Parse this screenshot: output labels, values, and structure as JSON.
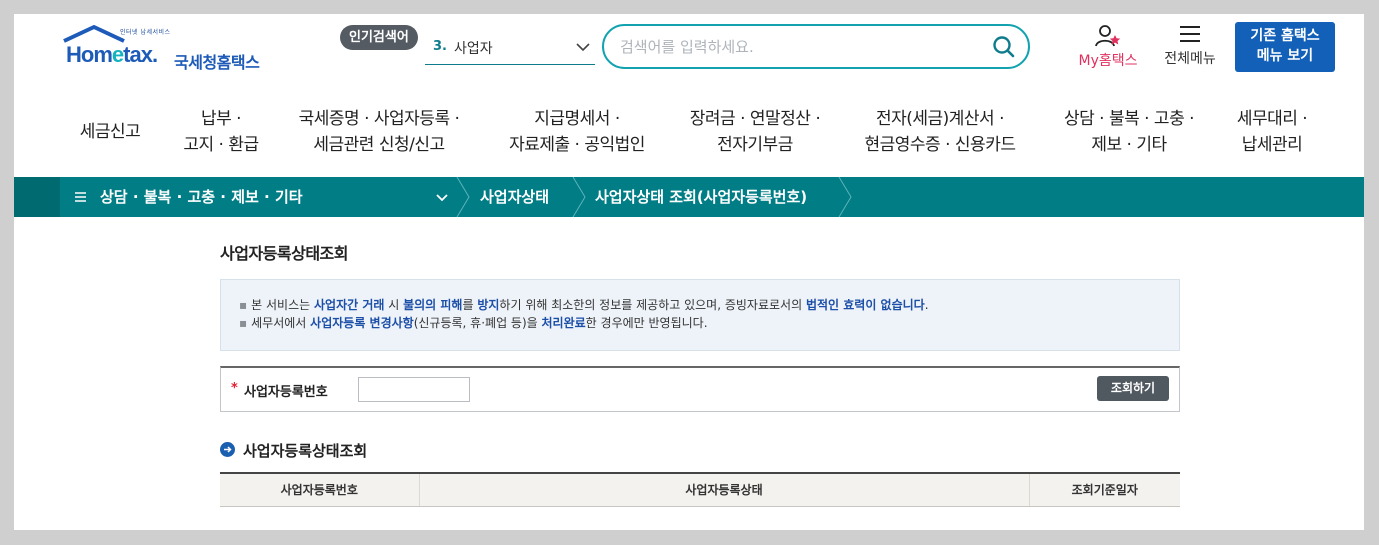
{
  "header": {
    "logo": {
      "tagline": "인터넷 납세서비스",
      "brand_prefix": "Hom",
      "brand_e": "e",
      "brand_suffix": "tax.",
      "brand_ko": "국세청홈택스"
    },
    "popular_label": "인기검색어",
    "popular_rank": "3.",
    "popular_keyword": "사업자",
    "search_placeholder": "검색어를 입력하세요.",
    "my_hometax_label": "My홈택스",
    "full_menu_label": "전체메뉴",
    "legacy_button": [
      "기존 홈택스",
      "메뉴 보기"
    ]
  },
  "nav": [
    {
      "lines": [
        "세금신고"
      ]
    },
    {
      "lines": [
        "납부 ·",
        "고지 · 환급"
      ]
    },
    {
      "lines": [
        "국세증명 · 사업자등록 ·",
        "세금관련 신청/신고"
      ]
    },
    {
      "lines": [
        "지급명세서 ·",
        "자료제출 · 공익법인"
      ]
    },
    {
      "lines": [
        "장려금 · 연말정산 ·",
        "전자기부금"
      ]
    },
    {
      "lines": [
        "전자(세금)계산서 ·",
        "현금영수증 · 신용카드"
      ]
    },
    {
      "lines": [
        "상담 · 불복 · 고충 ·",
        "제보 · 기타"
      ]
    },
    {
      "lines": [
        "세무대리 ·",
        "납세관리"
      ]
    }
  ],
  "breadcrumb": {
    "level1": "상담 · 불복 · 고충 · 제보 · 기타",
    "level2": "사업자상태",
    "level3": "사업자상태 조회(사업자등록번호)"
  },
  "page": {
    "title": "사업자등록상태조회",
    "notice": [
      [
        {
          "t": "본 서비스는 "
        },
        {
          "t": "사업자간 거래",
          "hl": "hl"
        },
        {
          "t": " 시 "
        },
        {
          "t": "불의의 피해",
          "hl": "hl"
        },
        {
          "t": "를 "
        },
        {
          "t": "방지",
          "hl": "hl"
        },
        {
          "t": "하기 위해 최소한의 정보를 제공하고 있으며, 증빙자료로서의 "
        },
        {
          "t": "법적인 효력이 없습니다",
          "hl": "hl"
        },
        {
          "t": "."
        }
      ],
      [
        {
          "t": "세무서에서 "
        },
        {
          "t": "사업자등록 변경사항",
          "hl": "hl"
        },
        {
          "t": "(신규등록, 휴·폐업 등)을 "
        },
        {
          "t": "처리완료",
          "hl": "hl"
        },
        {
          "t": "한 경우에만 반영됩니다."
        }
      ]
    ],
    "form": {
      "required_mark": "*",
      "label": "사업자등록번호",
      "value": "",
      "button": "조회하기"
    },
    "result_section_title": "사업자등록상태조회",
    "result_columns": [
      "사업자등록번호",
      "사업자등록상태",
      "조회기준일자"
    ]
  },
  "colors": {
    "teal": "#007d85",
    "brand_blue": "#1e5bb8",
    "my_pink": "#e0315f",
    "legacy_btn": "#1260b8"
  },
  "icons": [
    "house-logo-icon",
    "chevron-down-icon",
    "search-icon",
    "user-star-icon",
    "hamburger-icon",
    "menu-lines-icon",
    "arrow-circle-icon"
  ]
}
